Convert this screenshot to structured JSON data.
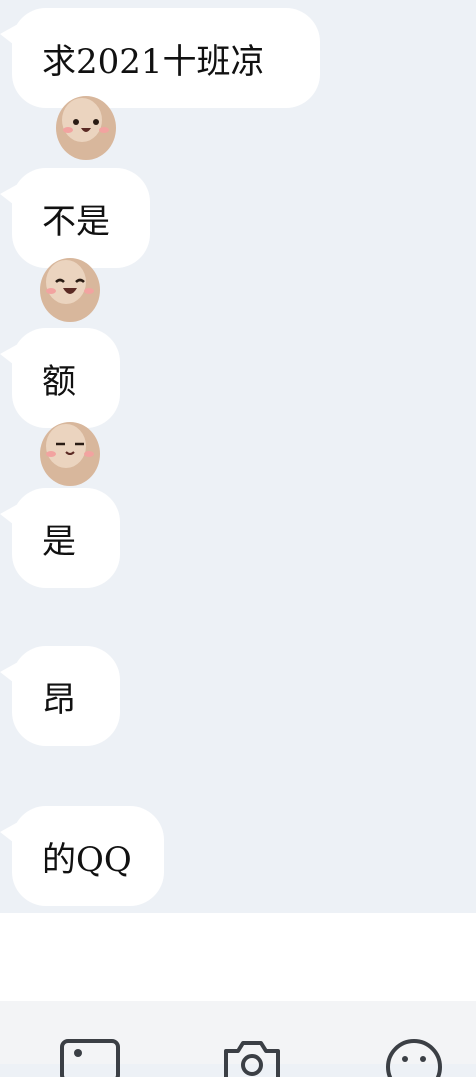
{
  "messages": [
    {
      "text": "求2021十班凉",
      "sticker": "egg-smile-sticker"
    },
    {
      "text": "不是",
      "sticker": "egg-laugh-sticker"
    },
    {
      "text": "额",
      "sticker": "egg-squint-sticker"
    },
    {
      "text": "是",
      "sticker": ""
    },
    {
      "text": "昂",
      "sticker": ""
    },
    {
      "text": "的QQ",
      "sticker": ""
    }
  ],
  "input": {
    "placeholder": ""
  },
  "toolbar": {
    "icons": [
      "image-icon",
      "camera-icon",
      "emoji-icon"
    ]
  },
  "colors": {
    "background": "#edf1f6",
    "bubble": "#ffffff",
    "toolbar": "#f3f4f6"
  }
}
